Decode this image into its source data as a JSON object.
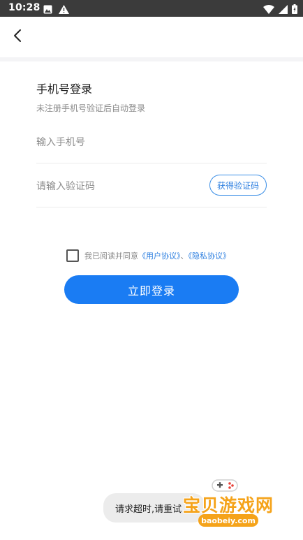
{
  "status_bar": {
    "time": "10:28",
    "icons_left": [
      "photo-icon",
      "warning-icon"
    ],
    "icons_right": [
      "wifi-icon",
      "signal-icon",
      "battery-icon"
    ]
  },
  "header": {
    "back_icon": "chevron-left-icon"
  },
  "login": {
    "title": "手机号登录",
    "subtitle": "未注册手机号验证后自动登录",
    "phone_placeholder": "输入手机号",
    "code_placeholder": "请输入验证码",
    "get_code_label": "获得验证码",
    "agreement_prefix": "我已阅读并同意",
    "user_agreement": "《用户协议》",
    "separator": "、",
    "privacy_agreement": "《隐私协议》",
    "submit_label": "立即登录"
  },
  "toast": {
    "message": "请求超时,请重试"
  },
  "watermark": {
    "title": "宝贝游戏网",
    "domain": "baobeiy.com"
  },
  "colors": {
    "status_bar": "#3b3b3b",
    "primary": "#1a7cf3",
    "link": "#2f80e0",
    "watermark": "#f5a31a"
  }
}
